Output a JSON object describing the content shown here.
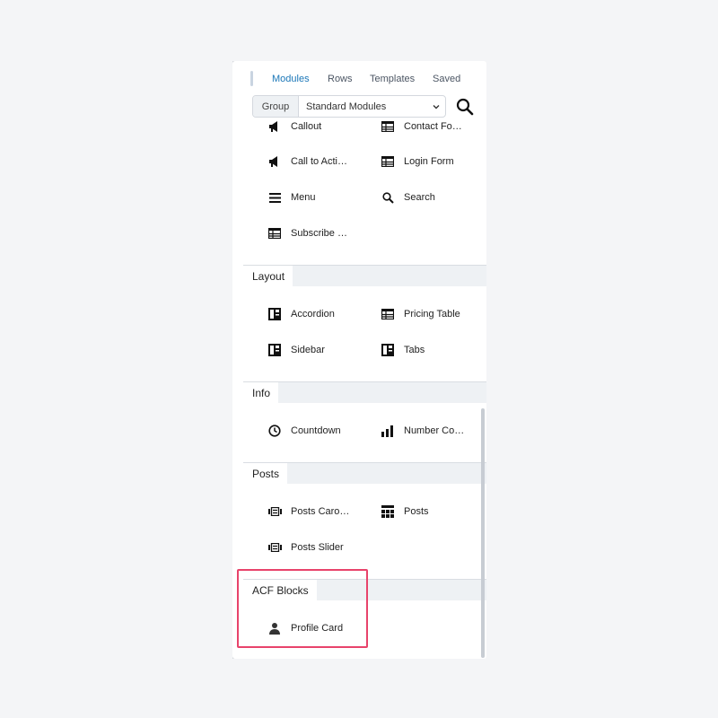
{
  "tabs": [
    {
      "label": "Modules",
      "active": true
    },
    {
      "label": "Rows",
      "active": false
    },
    {
      "label": "Templates",
      "active": false
    },
    {
      "label": "Saved",
      "active": false
    }
  ],
  "group": {
    "label": "Group",
    "value": "Standard Modules"
  },
  "modules_top": [
    {
      "label": "Callout",
      "icon": "megaphone-icon"
    },
    {
      "label": "Contact Fo…",
      "icon": "table-icon"
    },
    {
      "label": "Call to Acti…",
      "icon": "megaphone-icon"
    },
    {
      "label": "Login Form",
      "icon": "table-icon"
    },
    {
      "label": "Menu",
      "icon": "menu-icon"
    },
    {
      "label": "Search",
      "icon": "search-icon"
    },
    {
      "label": "Subscribe …",
      "icon": "table-icon"
    }
  ],
  "sections": {
    "layout": {
      "title": "Layout",
      "items": [
        {
          "label": "Accordion",
          "icon": "layout-icon"
        },
        {
          "label": "Pricing Table",
          "icon": "table-icon"
        },
        {
          "label": "Sidebar",
          "icon": "layout-icon"
        },
        {
          "label": "Tabs",
          "icon": "layout-icon"
        }
      ]
    },
    "info": {
      "title": "Info",
      "items": [
        {
          "label": "Countdown",
          "icon": "clock-icon"
        },
        {
          "label": "Number Co…",
          "icon": "bar-chart-icon"
        }
      ]
    },
    "posts": {
      "title": "Posts",
      "items": [
        {
          "label": "Posts Caro…",
          "icon": "carousel-icon"
        },
        {
          "label": "Posts",
          "icon": "grid-icon"
        },
        {
          "label": "Posts Slider",
          "icon": "carousel-icon"
        }
      ]
    },
    "acf": {
      "title": "ACF Blocks",
      "items": [
        {
          "label": "Profile Card",
          "icon": "user-icon"
        }
      ]
    }
  },
  "colors": {
    "accent": "#1b77b8",
    "highlight": "#e8436b",
    "section_bg": "#eef1f4"
  }
}
